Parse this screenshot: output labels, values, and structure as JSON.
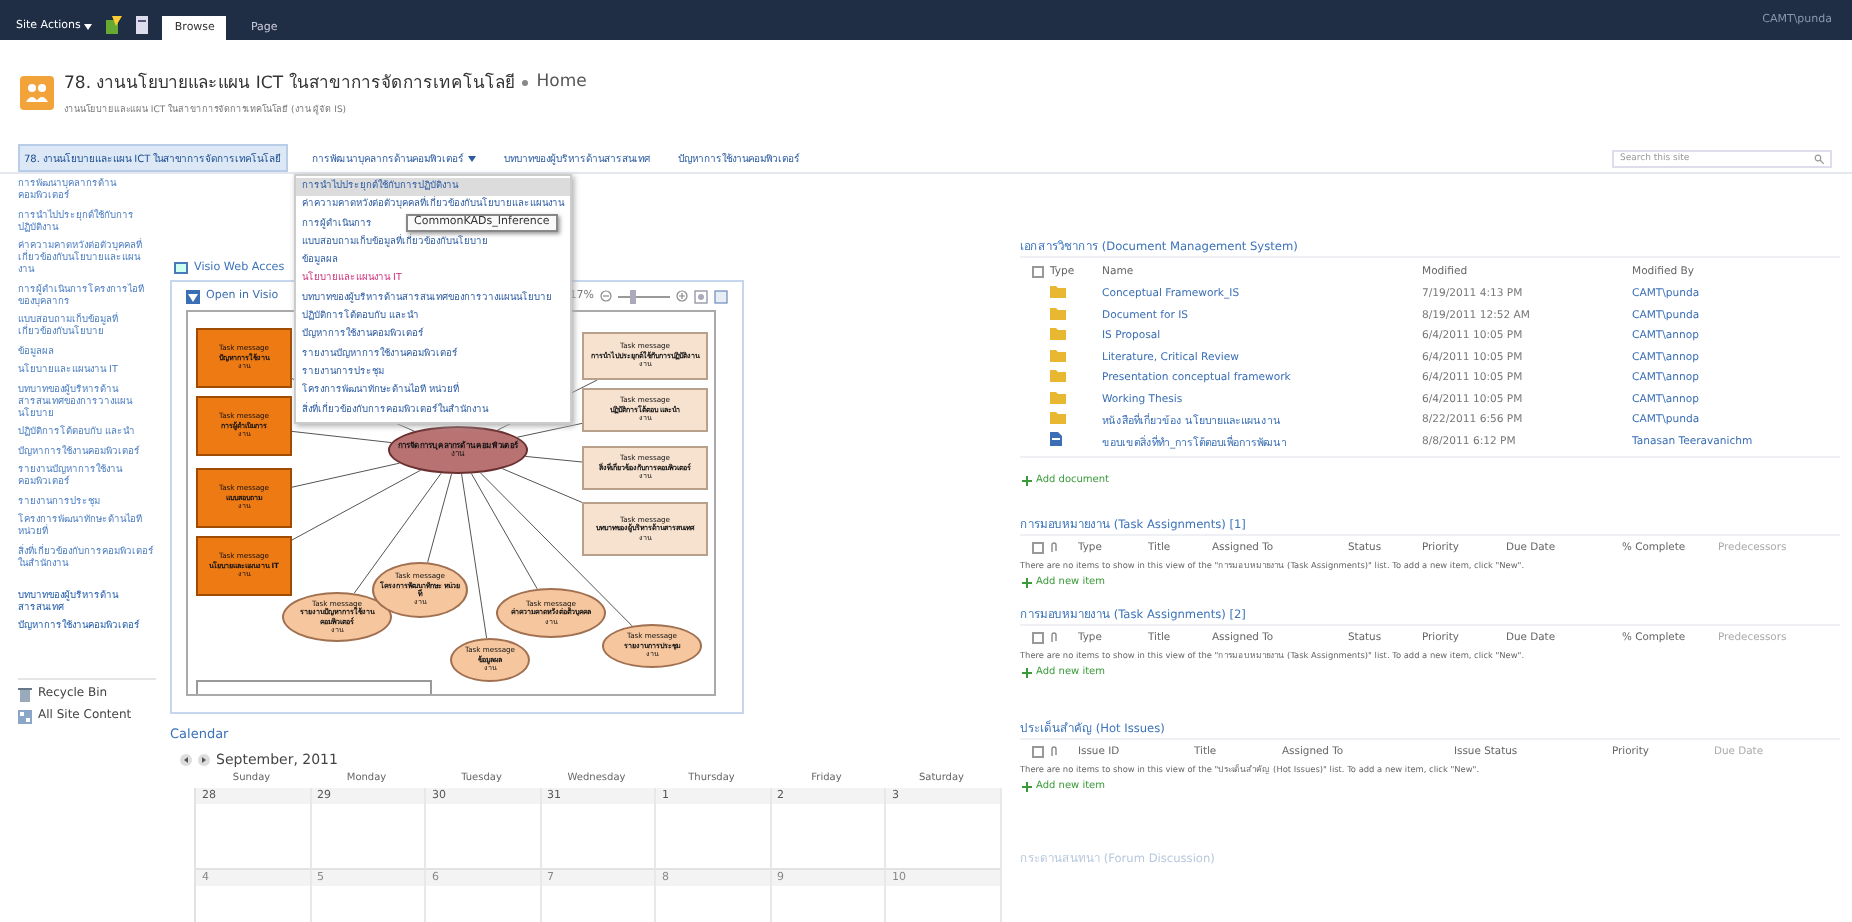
{
  "top_bar": {
    "site_actions": "Site Actions",
    "tabs": [
      {
        "label": "Browse",
        "selected": true
      },
      {
        "label": "Page",
        "selected": false
      }
    ],
    "user": "CAMT\\punda"
  },
  "header": {
    "title": "78. งานนโยบายและแผน ICT ในสาขาการจัดการเทคโนโลยี",
    "page": "Home",
    "subtitle": "งานนโยบายและแผน ICT ในสาขาการจัดการเทคโนโลยี (งาน ผู้จัด IS)"
  },
  "top_nav": {
    "items": [
      {
        "label": "78. งานนโยบายและแผน ICT ในสาขาการจัดการเทคโนโลยี",
        "selected": true,
        "has_menu": false
      },
      {
        "label": "การพัฒนาบุคลากรด้านคอมพิวเตอร์",
        "selected": false,
        "has_menu": true
      },
      {
        "label": "บทบาทของผู้บริหารด้านสารสนเทศ",
        "selected": false,
        "has_menu": false
      },
      {
        "label": "ปัญหาการใช้งานคอมพิวเตอร์",
        "selected": false,
        "has_menu": false
      }
    ],
    "search": {
      "placeholder": "Search this site"
    },
    "menu": {
      "items": [
        {
          "label": "การนำไปประยุกต์ใช้กับการปฏิบัติงาน",
          "hovered": true,
          "current": false
        },
        {
          "label": "ค่าความคาดหวังต่อตัวบุคคลที่เกี่ยวข้องกับนโยบายและแผนงาน",
          "hovered": false,
          "current": false
        },
        {
          "label": "การผู้ดำเนินการ",
          "hovered": false,
          "current": false
        },
        {
          "label": "แบบสอบถามเก็บข้อมูลที่เกี่ยวข้องกับนโยบาย",
          "hovered": false,
          "current": false
        },
        {
          "label": "ข้อมูลผล",
          "hovered": false,
          "current": false
        },
        {
          "label": "นโยบายและแผนงาน IT",
          "hovered": false,
          "current": true
        },
        {
          "label": "บทบาทของผู้บริหารด้านสารสนเทศของการวางแผนนโยบาย",
          "hovered": false,
          "current": false
        },
        {
          "label": "ปฏิบัติการโต้ตอบกับ และนำ",
          "hovered": false,
          "current": false
        },
        {
          "label": "ปัญหาการใช้งานคอมพิวเตอร์",
          "hovered": false,
          "current": false
        },
        {
          "label": "รายงานปัญหาการใช้งานคอมพิวเตอร์",
          "hovered": false,
          "current": false
        },
        {
          "label": "รายงานการประชุม",
          "hovered": false,
          "current": false
        },
        {
          "label": "โครงการพัฒนาทักษะด้านไอที หน่วยที่",
          "hovered": false,
          "current": false
        },
        {
          "label": "สิ่งที่เกี่ยวข้องกับการคอมพิวเตอร์ในสำนักงาน",
          "hovered": false,
          "current": false
        }
      ]
    },
    "tooltip": "CommonKADs_Inference"
  },
  "sidebar": {
    "items": [
      {
        "label": "การพัฒนาบุคลากรด้านคอมพิวเตอร์",
        "kind": "link"
      },
      {
        "label": "การนำไปประยุกต์ใช้กับการปฏิบัติงาน",
        "kind": "link"
      },
      {
        "label": "ค่าความคาดหวังต่อตัวบุคคลที่เกี่ยวข้องกับนโยบายและแผนงาน",
        "kind": "link"
      },
      {
        "label": "การผู้ดำเนินการโครงการไอทีของบุคลากร",
        "kind": "link"
      },
      {
        "label": "แบบสอบถามเก็บข้อมูลที่เกี่ยวข้องกับนโยบาย",
        "kind": "link"
      },
      {
        "label": "ข้อมูลผล",
        "kind": "link"
      },
      {
        "label": "นโยบายและแผนงาน IT",
        "kind": "link"
      },
      {
        "label": "บทบาทของผู้บริหารด้านสารสนเทศของการวางแผนนโยบาย",
        "kind": "link"
      },
      {
        "label": "ปฏิบัติการโต้ตอบกับ และนำ",
        "kind": "link"
      },
      {
        "label": "ปัญหาการใช้งานคอมพิวเตอร์",
        "kind": "link"
      },
      {
        "label": "รายงานปัญหาการใช้งานคอมพิวเตอร์",
        "kind": "link"
      },
      {
        "label": "รายงานการประชุม",
        "kind": "link"
      },
      {
        "label": "โครงการพัฒนาทักษะด้านไอที หน่วยที่",
        "kind": "link"
      },
      {
        "label": "สิ่งที่เกี่ยวข้องกับการคอมพิวเตอร์ในสำนักงาน",
        "kind": "link"
      },
      {
        "label": "บทบาทของผู้บริหารด้านสารสนเทศ",
        "kind": "heading"
      },
      {
        "label": "ปัญหาการใช้งานคอมพิวเตอร์",
        "kind": "heading"
      }
    ],
    "recycle_bin": "Recycle Bin",
    "all_content": "All Site Content"
  },
  "visio": {
    "title": "Visio Web Acces",
    "open_button": "Open in Visio",
    "zoom": "17%",
    "zoom_slider": {
      "level": 0.3
    },
    "nodes": [
      {
        "kind": "center",
        "title": "การจัดการบุคลากรด้านคอมพิวเตอร์",
        "footer": "งาน"
      },
      {
        "kind": "input",
        "header": "Task message",
        "title": "ปัญหาการใช้งาน",
        "footer": "งาน"
      },
      {
        "kind": "input",
        "header": "Task message",
        "title": "การผู้ดำเนินการ",
        "footer": "งาน"
      },
      {
        "kind": "input",
        "header": "Task message",
        "title": "แบบสอบถาม",
        "footer": "งาน"
      },
      {
        "kind": "input",
        "header": "Task message",
        "title": "นโยบายและแผนงาน IT",
        "footer": "งาน"
      },
      {
        "kind": "output",
        "header": "Task message",
        "title": "การนำไปประยุกต์ใช้กับการปฏิบัติงาน",
        "footer": "งาน"
      },
      {
        "kind": "output",
        "header": "Task message",
        "title": "ปฏิบัติการโต้ตอบ และนำ",
        "footer": "งาน"
      },
      {
        "kind": "output",
        "header": "Task message",
        "title": "สิ่งที่เกี่ยวข้องกับการคอมพิวเตอร์",
        "footer": "งาน"
      },
      {
        "kind": "output",
        "header": "Task message",
        "title": "บทบาทของผู้บริหารด้านสารสนเทศ",
        "footer": "งาน"
      },
      {
        "kind": "support",
        "header": "Task message",
        "title": "รายงานปัญหาการใช้งานคอมพิวเตอร์",
        "footer": "งาน"
      },
      {
        "kind": "support",
        "header": "Task message",
        "title": "โครงการพัฒนาทักษะ หน่วยที่",
        "footer": "งาน"
      },
      {
        "kind": "support",
        "header": "Task message",
        "title": "ข้อมูลผล",
        "footer": "งาน"
      },
      {
        "kind": "support",
        "header": "Task message",
        "title": "ค่าความคาดหวังต่อตัวบุคคล",
        "footer": "งาน"
      },
      {
        "kind": "support",
        "header": "Task message",
        "title": "รายงานการประชุม",
        "footer": "งาน"
      }
    ]
  },
  "calendar": {
    "title": "Calendar",
    "month": "September, 2011",
    "weekdays": [
      "Sunday",
      "Monday",
      "Tuesday",
      "Wednesday",
      "Thursday",
      "Friday",
      "Saturday"
    ],
    "weeks": [
      [
        "28",
        "29",
        "30",
        "31",
        "1",
        "2",
        "3"
      ],
      [
        "4",
        "5",
        "6",
        "7",
        "8",
        "9",
        "10"
      ]
    ]
  },
  "documents": {
    "title": "เอกสารวิชาการ (Document Management System)",
    "select_all": {
      "checked": false
    },
    "columns": [
      "Type",
      "Name",
      "Modified",
      "Modified By"
    ],
    "rows": [
      {
        "kind": "folder",
        "name": "Conceptual Framework_IS",
        "modified": "7/19/2011 4:13 PM",
        "modified_by": "CAMT\\punda"
      },
      {
        "kind": "folder",
        "name": "Document for IS",
        "modified": "8/19/2011 12:52 AM",
        "modified_by": "CAMT\\punda"
      },
      {
        "kind": "folder",
        "name": "IS Proposal",
        "modified": "6/4/2011 10:05 PM",
        "modified_by": "CAMT\\annop"
      },
      {
        "kind": "folder",
        "name": "Literature, Critical Review",
        "modified": "6/4/2011 10:05 PM",
        "modified_by": "CAMT\\annop"
      },
      {
        "kind": "folder",
        "name": "Presentation conceptual framework",
        "modified": "6/4/2011 10:05 PM",
        "modified_by": "CAMT\\annop"
      },
      {
        "kind": "folder",
        "name": "Working Thesis",
        "modified": "6/4/2011 10:05 PM",
        "modified_by": "CAMT\\annop"
      },
      {
        "kind": "folder",
        "name": "หนังสือที่เกี่ยวข้อง นโยบายและแผนงาน",
        "modified": "8/22/2011 6:56 PM",
        "modified_by": "CAMT\\punda"
      },
      {
        "kind": "document",
        "name": "ขอบเขตสิ่งที่ทำ_การโต้ตอบเพื่อการพัฒนา",
        "modified": "8/8/2011 6:12 PM",
        "modified_by": "Tanasan Teeravanichm"
      }
    ],
    "add": "Add document"
  },
  "lists": [
    {
      "kind": "tasks",
      "title": "การมอบหมายงาน (Task Assignments) [1]",
      "select_all": {
        "checked": false
      },
      "columns": [
        "Type",
        "Title",
        "Assigned To",
        "Status",
        "Priority",
        "Due Date",
        "% Complete",
        "Predecessors"
      ],
      "message": "There are no items to show in this view of the \"การมอบหมายงาน (Task Assignments)\" list. To add a new item, click \"New\".",
      "add": "Add new item"
    },
    {
      "kind": "tasks",
      "title": "การมอบหมายงาน (Task Assignments) [2]",
      "select_all": {
        "checked": false
      },
      "columns": [
        "Type",
        "Title",
        "Assigned To",
        "Status",
        "Priority",
        "Due Date",
        "% Complete",
        "Predecessors"
      ],
      "message": "There are no items to show in this view of the \"การมอบหมายงาน (Task Assignments)\" list. To add a new item, click \"New\".",
      "add": "Add new item"
    },
    {
      "kind": "issues",
      "title": "ประเด็นสำคัญ (Hot Issues)",
      "select_all": {
        "checked": false
      },
      "columns": [
        "Issue ID",
        "Title",
        "Assigned To",
        "Issue Status",
        "Priority",
        "Due Date"
      ],
      "message": "There are no items to show in this view of the \"ประเด็นสำคัญ (Hot Issues)\" list. To add a new item, click \"New\".",
      "add": "Add new item"
    }
  ],
  "forum": {
    "title": "กระดานสนทนา (Forum Discussion)"
  }
}
